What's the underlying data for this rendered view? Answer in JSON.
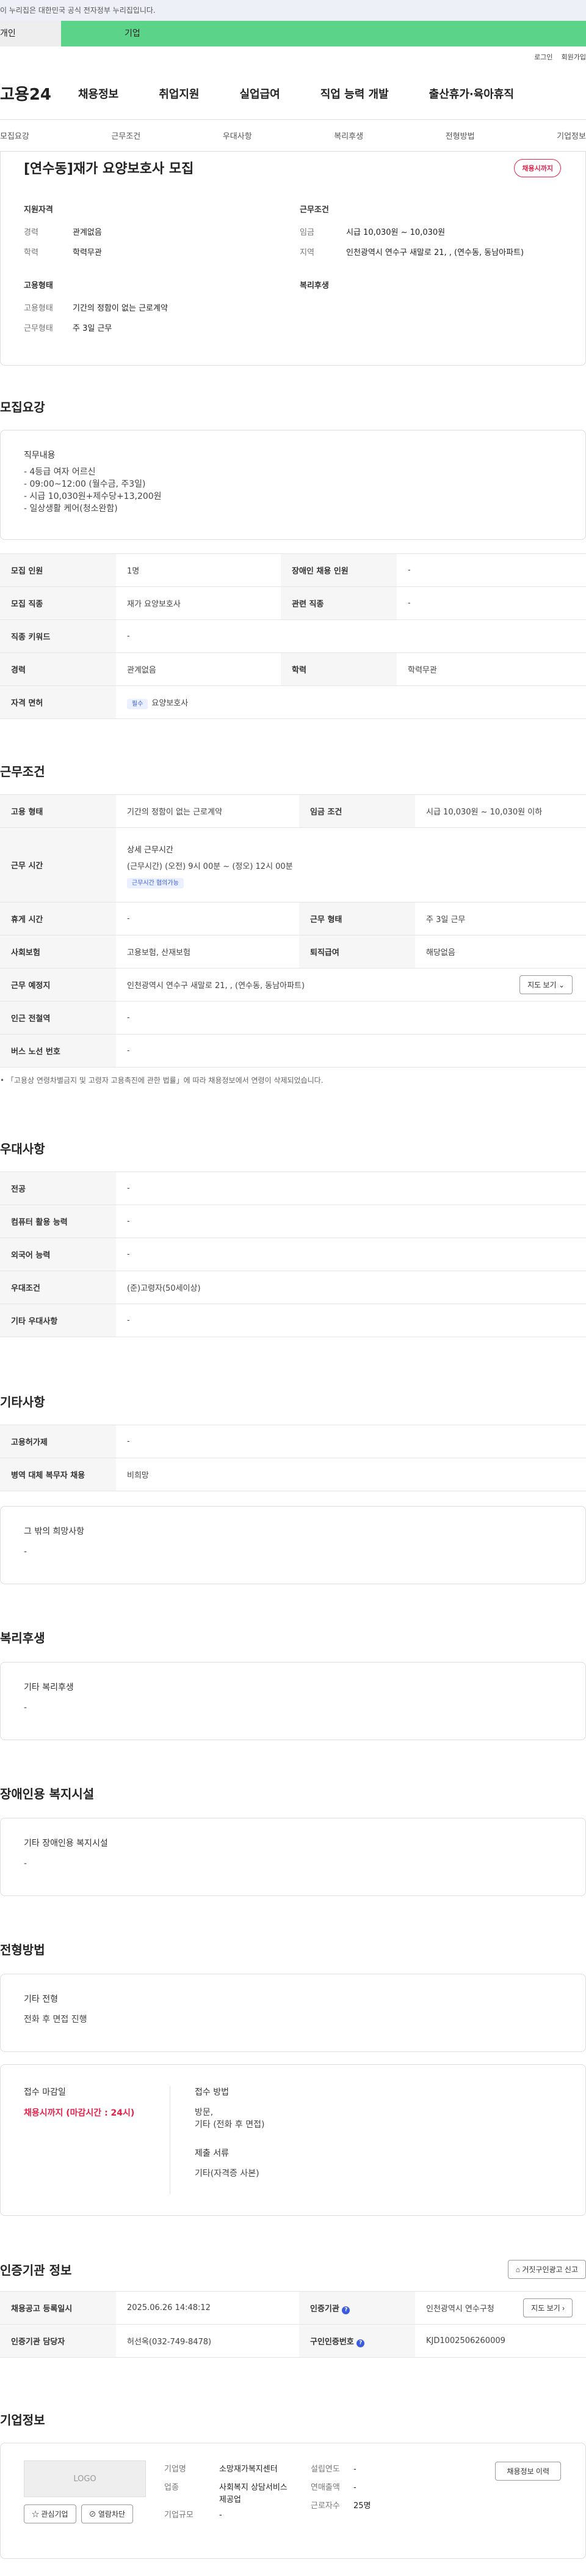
{
  "banner": "이 누리집은 대한민국 공식 전자정부 누리집입니다.",
  "user_tabs": [
    "개인",
    "기업"
  ],
  "top_links": [
    "로그인",
    "회원가입"
  ],
  "logo": "고용24",
  "gnb": [
    "채용정보",
    "취업지원",
    "실업급여",
    "직업 능력 개발",
    "출산휴가·육아휴직"
  ],
  "subnav": [
    "모집요강",
    "근무조건",
    "우대사항",
    "복리후생",
    "전형방법",
    "기업정보"
  ],
  "head": {
    "title": "[연수동]재가 요양보호사 모집",
    "deadline_badge": "채용시까지",
    "qual_h": "지원자격",
    "career_k": "경력",
    "career_v": "관계없음",
    "edu_k": "학력",
    "edu_v": "학력무관",
    "cond_h": "근무조건",
    "wage_k": "임금",
    "wage_v": "시급 10,030원 ~ 10,030원",
    "region_k": "지역",
    "region_v": "인천광역시 연수구 새말로 21, , (연수동, 동남아파트)",
    "emp_h": "고용형태",
    "emp_type_k": "고용형태",
    "emp_type_v": "기간의 정함이 없는 근로계약",
    "work_k": "근무형태",
    "work_v": "주 3일 근무",
    "welfare_h": "복리후생"
  },
  "recruit": {
    "title": "모집요강",
    "duty_h": "직무내용",
    "duty_v": "- 4등급 여자 어르신\n- 09:00~12:00 (월수금, 주3일)\n- 시급 10,030원+제수당+13,200원\n- 일상생활 케어(청소완함)",
    "rows": {
      "count_k": "모집 인원",
      "count_v": "1명",
      "disabled_k": "장애인 채용 인원",
      "disabled_v": "-",
      "job_k": "모집 직종",
      "job_v": "재가 요양보호사",
      "related_k": "관련 직종",
      "related_v": "-",
      "keyword_k": "직종 키워드",
      "keyword_v": "-",
      "career_k": "경력",
      "career_v": "관계없음",
      "edu_k": "학력",
      "edu_v": "학력무관",
      "license_k": "자격 면허",
      "license_chip": "필수",
      "license_v": "요양보호사"
    }
  },
  "conditions": {
    "title": "근무조건",
    "emp_k": "고용 형태",
    "emp_v": "기간의 정함이 없는 근로계약",
    "wage_k": "임금 조건",
    "wage_v": "시급 10,030원 ~ 10,030원 이하",
    "hours_k": "근무 시간",
    "hours_h": "상세 근무시간",
    "hours_v": "(근무시간) (오전) 9시 00분 ~ (정오) 12시 00분",
    "hours_chip": "근무시간 협의가능",
    "rest_k": "휴게 시간",
    "rest_v": "-",
    "form_k": "근무 형태",
    "form_v": "주 3일 근무",
    "ins_k": "사회보험",
    "ins_v": "고용보험, 산재보험",
    "sev_k": "퇴직급여",
    "sev_v": "해당없음",
    "place_k": "근무 예정지",
    "place_v": "인천광역시 연수구 새말로 21, , (연수동, 동남아파트)",
    "map_btn": "지도 보기",
    "subway_k": "인근 전철역",
    "subway_v": "-",
    "bus_k": "버스 노선 번호",
    "bus_v": "-",
    "note": "「고용상 연령차별금지 및 고령자 고용촉진에 관한 법률」에 따라 채용정보에서 연령이 삭제되었습니다."
  },
  "pref": {
    "title": "우대사항",
    "rows": [
      {
        "k": "전공",
        "v": "-"
      },
      {
        "k": "컴퓨터 활용 능력",
        "v": "-"
      },
      {
        "k": "외국어 능력",
        "v": "-"
      },
      {
        "k": "우대조건",
        "v": "(준)고령자(50세이상)"
      },
      {
        "k": "기타 우대사항",
        "v": "-"
      }
    ]
  },
  "etc": {
    "title": "기타사항",
    "rows": [
      {
        "k": "고용허가제",
        "v": "-"
      },
      {
        "k": "병역 대체 복무자 채용",
        "v": "비희망"
      }
    ],
    "box_h": "그 밖의 희망사항",
    "box_v": "-"
  },
  "welfare": {
    "title": "복리후생",
    "box_h": "기타 복리후생",
    "box_v": "-"
  },
  "disab": {
    "title": "장애인용 복지시설",
    "box_h": "기타 장애인용 복지시설",
    "box_v": "-"
  },
  "select": {
    "title": "전형방법",
    "box_h": "기타 전형",
    "box_v": "전화 후 면접 진행",
    "deadline_h": "접수 마감일",
    "deadline_v": "채용시까지 (마감시간 : 24시)",
    "method_h": "접수 방법",
    "method_v": "방문,\n기타 (전화 후 면접)",
    "docs_h": "제출 서류",
    "docs_v": "기타(자격증 사본)"
  },
  "cert": {
    "title": "인증기관 정보",
    "report_btn": "거짓구인광고 신고",
    "reg_k": "채용공고 등록일시",
    "reg_v": "2025.06.26 14:48:12",
    "org_k": "인증기관",
    "org_v": "인천광역시 연수구청",
    "map_btn": "지도 보기",
    "mgr_k": "인증기관 담당자",
    "mgr_v": "허선옥(032-749-8478)",
    "id_k": "구인인증번호",
    "id_v": "KJD1002506260009"
  },
  "company": {
    "title": "기업정보",
    "logo": "LOGO",
    "fav_btn": "관심기업",
    "block_btn": "열람차단",
    "hist_btn": "채용정보 이력",
    "name_k": "기업명",
    "name_v": "소망재가복지센터",
    "biz_k": "업종",
    "biz_v": "사회복지 상담서비스 제공업",
    "year_k": "설립연도",
    "year_v": "-",
    "sales_k": "연매출액",
    "sales_v": "-",
    "emp_k": "근로자수",
    "emp_v": "25명",
    "scale_k": "기업규모",
    "scale_v": "-"
  }
}
